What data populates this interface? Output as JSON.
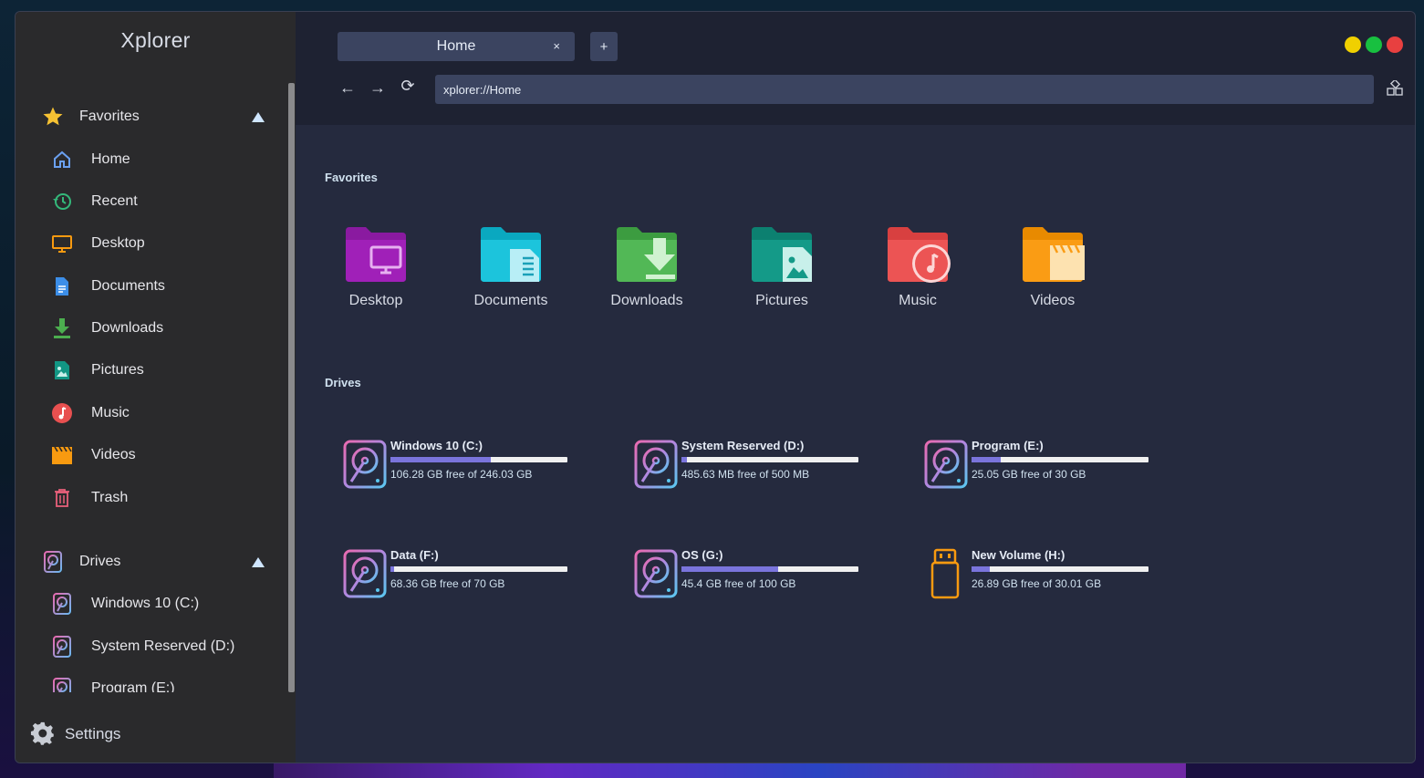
{
  "app": {
    "title": "Xplorer"
  },
  "sidebar": {
    "favorites_label": "Favorites",
    "favorites": [
      {
        "label": "Home",
        "icon": "home-icon"
      },
      {
        "label": "Recent",
        "icon": "recent-icon"
      },
      {
        "label": "Desktop",
        "icon": "desktop-icon"
      },
      {
        "label": "Documents",
        "icon": "document-icon"
      },
      {
        "label": "Downloads",
        "icon": "download-icon"
      },
      {
        "label": "Pictures",
        "icon": "picture-icon"
      },
      {
        "label": "Music",
        "icon": "music-icon"
      },
      {
        "label": "Videos",
        "icon": "video-icon"
      },
      {
        "label": "Trash",
        "icon": "trash-icon"
      }
    ],
    "drives_label": "Drives",
    "drives": [
      {
        "label": "Windows 10 (C:)"
      },
      {
        "label": "System Reserved (D:)"
      },
      {
        "label": "Program (E:)"
      }
    ],
    "settings_label": "Settings"
  },
  "tabs": [
    {
      "label": "Home",
      "close": "×"
    }
  ],
  "new_tab_label": "+",
  "toolbar": {
    "back": "←",
    "forward": "→",
    "reload": "⟳"
  },
  "address": {
    "value": "xplorer://Home"
  },
  "colors": {
    "accent": "#3b4460",
    "close": "#e84040",
    "maximize": "#18c040",
    "minimize": "#f0d000",
    "usage_bar": "#7a74dc"
  },
  "main": {
    "favorites_title": "Favorites",
    "favorites": [
      {
        "label": "Desktop",
        "color": "#9b1fb0"
      },
      {
        "label": "Documents",
        "color": "#1cbcd4"
      },
      {
        "label": "Downloads",
        "color": "#4cae4f"
      },
      {
        "label": "Pictures",
        "color": "#129684"
      },
      {
        "label": "Music",
        "color": "#e85050"
      },
      {
        "label": "Videos",
        "color": "#f89a10"
      }
    ],
    "drives_title": "Drives",
    "drives": [
      {
        "name": "Windows 10 (C:)",
        "free": "106.28 GB free of 246.03 GB",
        "used": 0.568,
        "type": "hdd"
      },
      {
        "name": "System Reserved (D:)",
        "free": "485.63 MB free of 500 MB",
        "used": 0.029,
        "type": "hdd"
      },
      {
        "name": "Program (E:)",
        "free": "25.05 GB free of 30 GB",
        "used": 0.165,
        "type": "hdd"
      },
      {
        "name": "Data (F:)",
        "free": "68.36 GB free of 70 GB",
        "used": 0.023,
        "type": "hdd"
      },
      {
        "name": "OS (G:)",
        "free": "45.4 GB free of 100 GB",
        "used": 0.546,
        "type": "hdd"
      },
      {
        "name": "New Volume (H:)",
        "free": "26.89 GB free of 30.01 GB",
        "used": 0.104,
        "type": "usb"
      }
    ]
  }
}
